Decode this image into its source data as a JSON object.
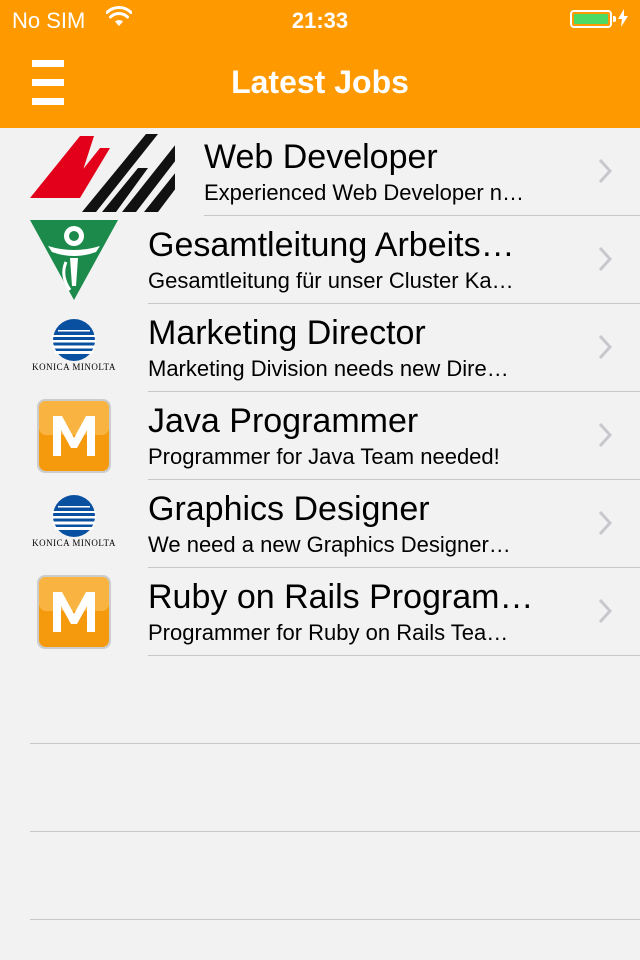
{
  "status_bar": {
    "carrier": "No SIM",
    "time": "21:33",
    "battery_level": 1.0,
    "battery_color": "#4cd964"
  },
  "nav": {
    "title": "Latest Jobs",
    "menu_icon": "hamburger-menu-icon",
    "background": "#ff9900"
  },
  "jobs": [
    {
      "title": "Web Developer",
      "subtitle": "Experienced Web Developer n…",
      "logo": "avm-logo",
      "logo_text": "AVM"
    },
    {
      "title": "Gesamtleitung Arbeits…",
      "subtitle": "Gesamtleitung für unser Cluster Ka…",
      "logo": "green-emblem-logo"
    },
    {
      "title": "Marketing Director",
      "subtitle": "Marketing Division needs new Dire…",
      "logo": "konica-minolta-logo",
      "logo_text": "KONICA MINOLTA"
    },
    {
      "title": "Java Programmer",
      "subtitle": "Programmer for Java Team needed!",
      "logo": "orange-m-logo",
      "logo_text": "M"
    },
    {
      "title": "Graphics Designer",
      "subtitle": "We need a new Graphics Designer…",
      "logo": "konica-minolta-logo",
      "logo_text": "KONICA MINOLTA"
    },
    {
      "title": "Ruby on Rails Program…",
      "subtitle": "Programmer for Ruby on Rails Tea…",
      "logo": "orange-m-logo",
      "logo_text": "M"
    }
  ]
}
